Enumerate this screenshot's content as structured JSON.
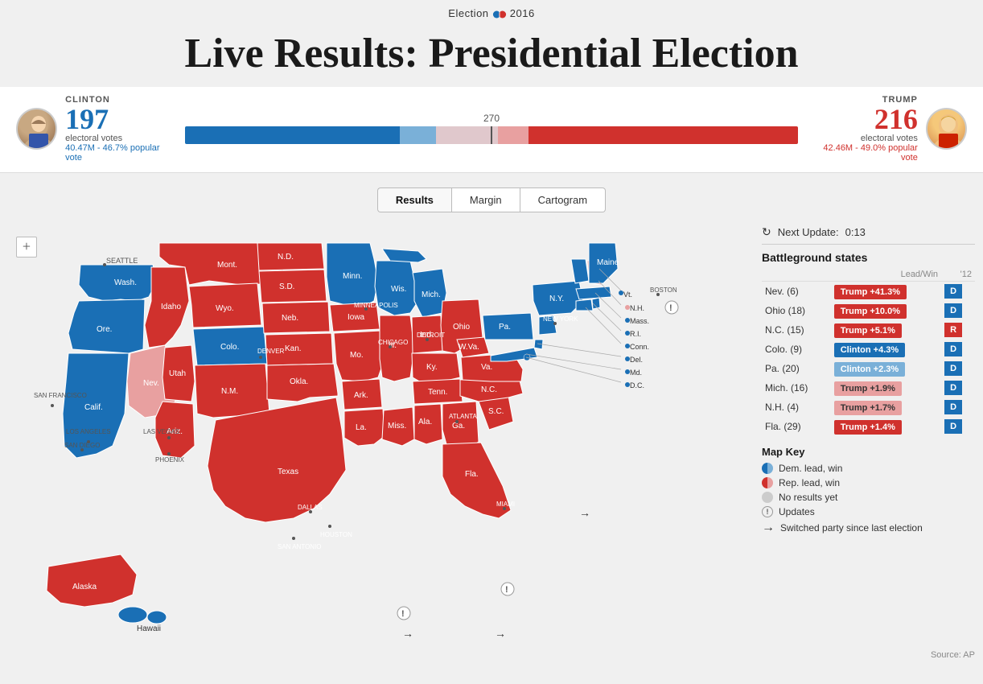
{
  "header": {
    "election_label": "Election",
    "year": "2016",
    "main_title": "Live Results: Presidential Election"
  },
  "candidates": {
    "clinton": {
      "name": "CLINTON",
      "electoral_votes": "197",
      "vote_label": "electoral votes",
      "popular_vote": "40.47M - 46.7% popular vote",
      "color": "#1a6fb5"
    },
    "trump": {
      "name": "TRUMP",
      "electoral_votes": "216",
      "vote_label": "electoral votes",
      "popular_vote": "42.46M - 49.0% popular vote",
      "color": "#d0312d"
    },
    "threshold": "270"
  },
  "tabs": {
    "results": "Results",
    "margin": "Margin",
    "cartogram": "Cartogram",
    "active": "results"
  },
  "update": {
    "label": "Next Update:",
    "time": "0:13"
  },
  "battleground": {
    "title": "Battleground states",
    "col_lead": "Lead/Win",
    "col_year": "'12",
    "states": [
      {
        "name": "Nev. (6)",
        "lead_text": "Trump +41.3%",
        "lead_type": "trump",
        "year12": "D"
      },
      {
        "name": "Ohio (18)",
        "lead_text": "Trump +10.0%",
        "lead_type": "trump",
        "year12": "D"
      },
      {
        "name": "N.C. (15)",
        "lead_text": "Trump +5.1%",
        "lead_type": "trump",
        "year12": "R"
      },
      {
        "name": "Colo. (9)",
        "lead_text": "Clinton +4.3%",
        "lead_type": "clinton",
        "year12": "D"
      },
      {
        "name": "Pa. (20)",
        "lead_text": "Clinton +2.3%",
        "lead_type": "clinton-light",
        "year12": "D"
      },
      {
        "name": "Mich. (16)",
        "lead_text": "Trump +1.9%",
        "lead_type": "trump-light",
        "year12": "D"
      },
      {
        "name": "N.H. (4)",
        "lead_text": "Trump +1.7%",
        "lead_type": "trump-light",
        "year12": "D"
      },
      {
        "name": "Fla. (29)",
        "lead_text": "Trump +1.4%",
        "lead_type": "trump",
        "year12": "D"
      }
    ]
  },
  "map_key": {
    "title": "Map Key",
    "items": [
      {
        "type": "dem-lead",
        "label": "Dem. lead, win"
      },
      {
        "type": "rep-lead",
        "label": "Rep. lead, win"
      },
      {
        "type": "none",
        "label": "No results yet"
      },
      {
        "type": "updates",
        "label": "Updates"
      },
      {
        "type": "switched",
        "label": "Switched party since last election"
      }
    ]
  },
  "source": "Source: AP",
  "zoom_plus": "+"
}
